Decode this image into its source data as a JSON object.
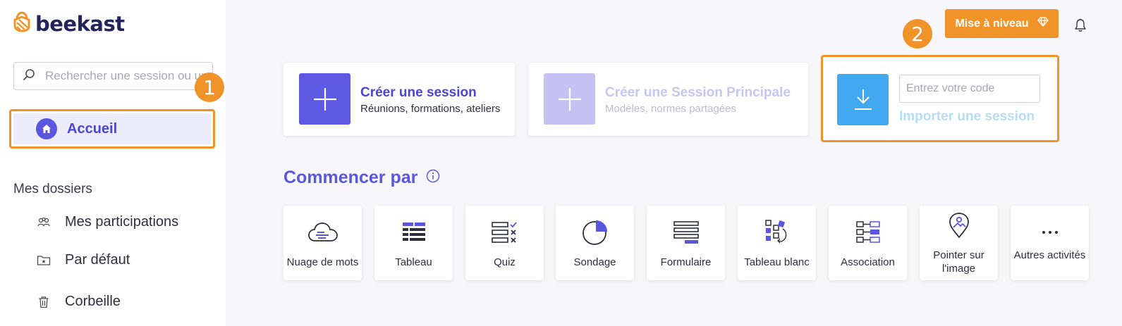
{
  "brand": {
    "name": "beekast",
    "accent": "#5b56e0",
    "orange": "#f0942a",
    "blue": "#42a8ef"
  },
  "sidebar": {
    "search_placeholder": "Rechercher une session ou un dossier",
    "home_label": "Accueil",
    "section_title": "Mes dossiers",
    "items": [
      {
        "label": "Mes participations",
        "icon": "people-icon"
      },
      {
        "label": "Par défaut",
        "icon": "folder-star-icon"
      },
      {
        "label": "Corbeille",
        "icon": "trash-icon"
      }
    ]
  },
  "badges": {
    "one": "1",
    "two": "2"
  },
  "header": {
    "upgrade_label": "Mise à niveau",
    "upgrade_icon": "diamond-icon",
    "bell_icon": "bell-icon"
  },
  "cards": {
    "create": {
      "title": "Créer une session",
      "subtitle": "Réunions, formations, ateliers"
    },
    "main": {
      "title": "Créer une Session Principale",
      "subtitle": "Modèles, normes partagées"
    },
    "import": {
      "placeholder": "Entrez votre code",
      "link": "Importer une session"
    }
  },
  "start": {
    "title": "Commencer par",
    "tiles": [
      {
        "label": "Nuage de mots",
        "icon": "cloud-icon"
      },
      {
        "label": "Tableau",
        "icon": "table-icon"
      },
      {
        "label": "Quiz",
        "icon": "quiz-icon"
      },
      {
        "label": "Sondage",
        "icon": "pie-chart-icon"
      },
      {
        "label": "Formulaire",
        "icon": "form-icon"
      },
      {
        "label": "Tableau blanc",
        "icon": "whiteboard-icon"
      },
      {
        "label": "Association",
        "icon": "association-icon"
      },
      {
        "label": "Pointer sur l'image",
        "icon": "map-pin-icon"
      },
      {
        "label": "Autres activités",
        "icon": "more-icon"
      }
    ]
  }
}
